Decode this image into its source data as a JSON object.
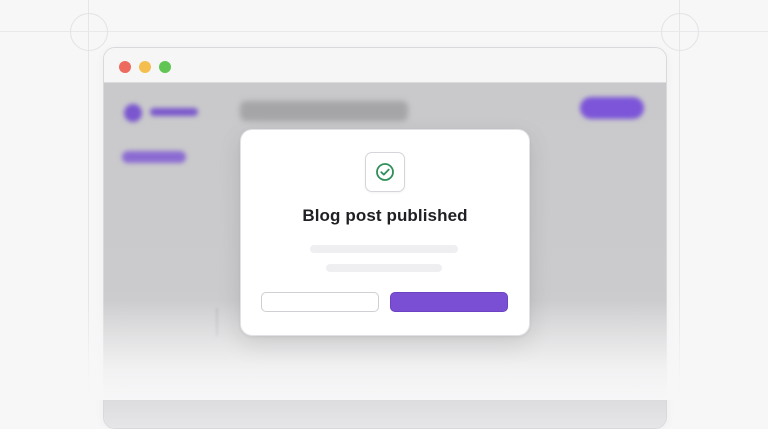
{
  "window": {
    "traffic_lights": {
      "close": "#ec6a5e",
      "minimize": "#f4bf4f",
      "maximize": "#61c554"
    }
  },
  "modal": {
    "icon": "check-circle-icon",
    "icon_color": "#2f8f5b",
    "title": "Blog post published",
    "secondary_button_label": "",
    "primary_button_label": ""
  },
  "colors": {
    "accent": "#7b4fd3",
    "background": "#f7f7f8",
    "overlay": "#c9c9cb"
  }
}
